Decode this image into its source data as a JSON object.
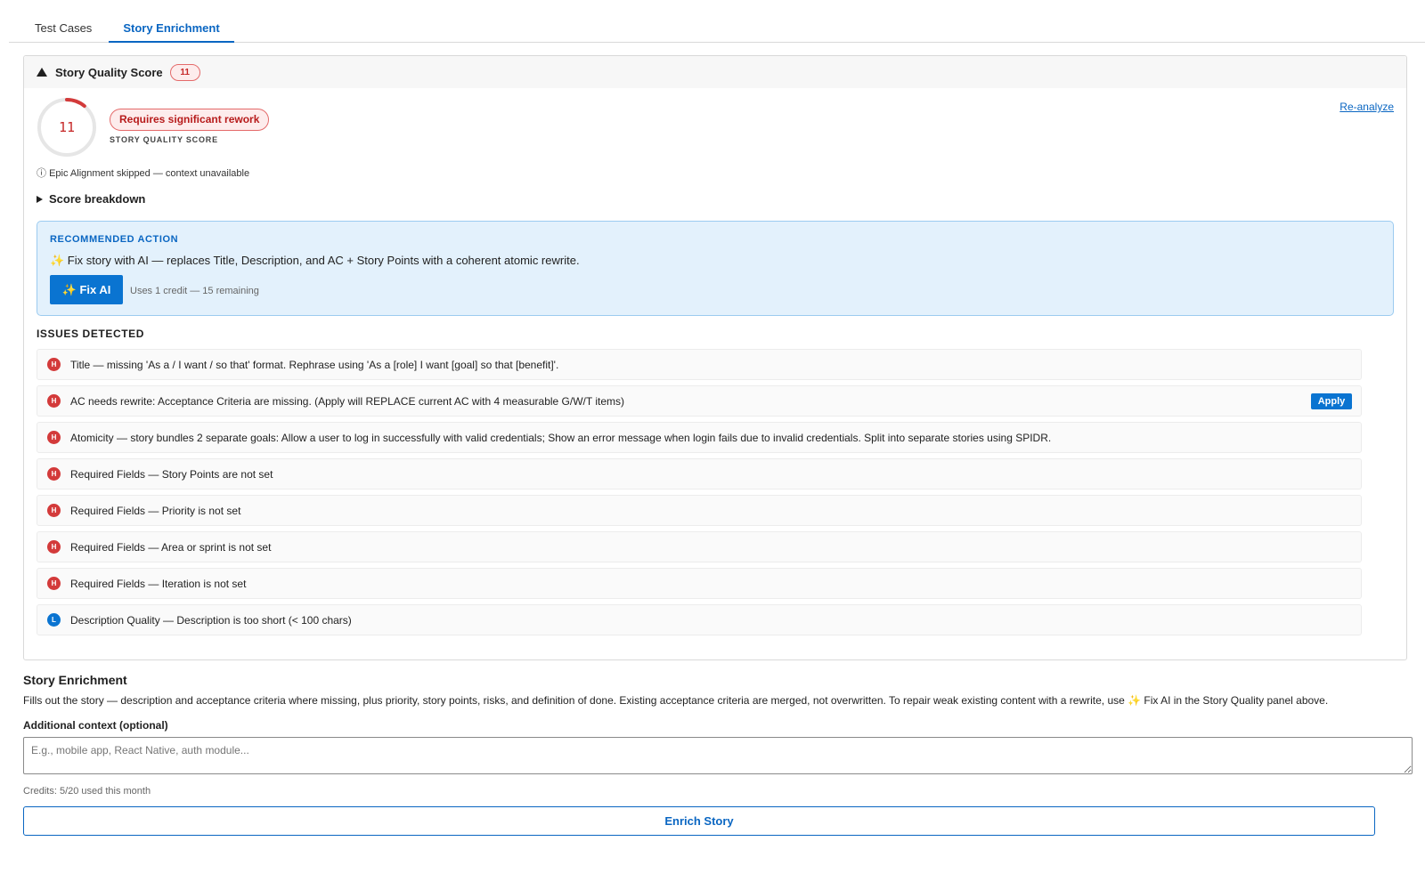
{
  "tabs": [
    {
      "label": "Test Cases",
      "active": false
    },
    {
      "label": "Story Enrichment",
      "active": true
    }
  ],
  "quality_panel": {
    "title": "Story Quality Score",
    "score_badge": "11",
    "score": "11",
    "score_max": 100,
    "score_color": "#d33a3a",
    "status_badge": "Requires significant rework",
    "score_label": "STORY QUALITY SCORE",
    "reanalyze_label": "Re-analyze",
    "epic_note_icon": "ⓘ",
    "epic_note": "Epic Alignment skipped — context unavailable",
    "breakdown_label": "Score breakdown"
  },
  "recommended": {
    "title": "RECOMMENDED ACTION",
    "text": "✨ Fix story with AI — replaces Title, Description, and AC + Story Points with a coherent atomic rewrite.",
    "fix_button": "✨ Fix AI",
    "credit_note": "Uses 1 credit — 15 remaining"
  },
  "issues": {
    "title": "ISSUES DETECTED",
    "items": [
      {
        "severity": "H",
        "text": "Title — missing 'As a / I want / so that' format. Rephrase using 'As a [role] I want [goal] so that [benefit]'."
      },
      {
        "severity": "H",
        "text": "AC needs rewrite: Acceptance Criteria are missing. (Apply will REPLACE current AC with 4 measurable G/W/T items)",
        "action": "Apply"
      },
      {
        "severity": "H",
        "text": "Atomicity — story bundles 2 separate goals: Allow a user to log in successfully with valid credentials; Show an error message when login fails due to invalid credentials. Split into separate stories using SPIDR."
      },
      {
        "severity": "H",
        "text": "Required Fields — Story Points are not set"
      },
      {
        "severity": "H",
        "text": "Required Fields — Priority is not set"
      },
      {
        "severity": "H",
        "text": "Required Fields — Area or sprint is not set"
      },
      {
        "severity": "H",
        "text": "Required Fields — Iteration is not set"
      },
      {
        "severity": "L",
        "text": "Description Quality — Description is too short (< 100 chars)"
      }
    ]
  },
  "enrichment": {
    "title": "Story Enrichment",
    "description": "Fills out the story — description and acceptance criteria where missing, plus priority, story points, risks, and definition of done. Existing acceptance criteria are merged, not overwritten. To repair weak existing content with a rewrite, use ✨ Fix AI in the Story Quality panel above.",
    "context_label": "Additional context (optional)",
    "context_value": "",
    "context_placeholder": "E.g., mobile app, React Native, auth module...",
    "credits_used": "Credits: 5/20 used this month",
    "enrich_button": "Enrich Story"
  },
  "colors": {
    "accent": "#0a66c2",
    "high": "#d33a3a",
    "low": "#0a74d1",
    "rec_bg": "#e3f1fc"
  }
}
